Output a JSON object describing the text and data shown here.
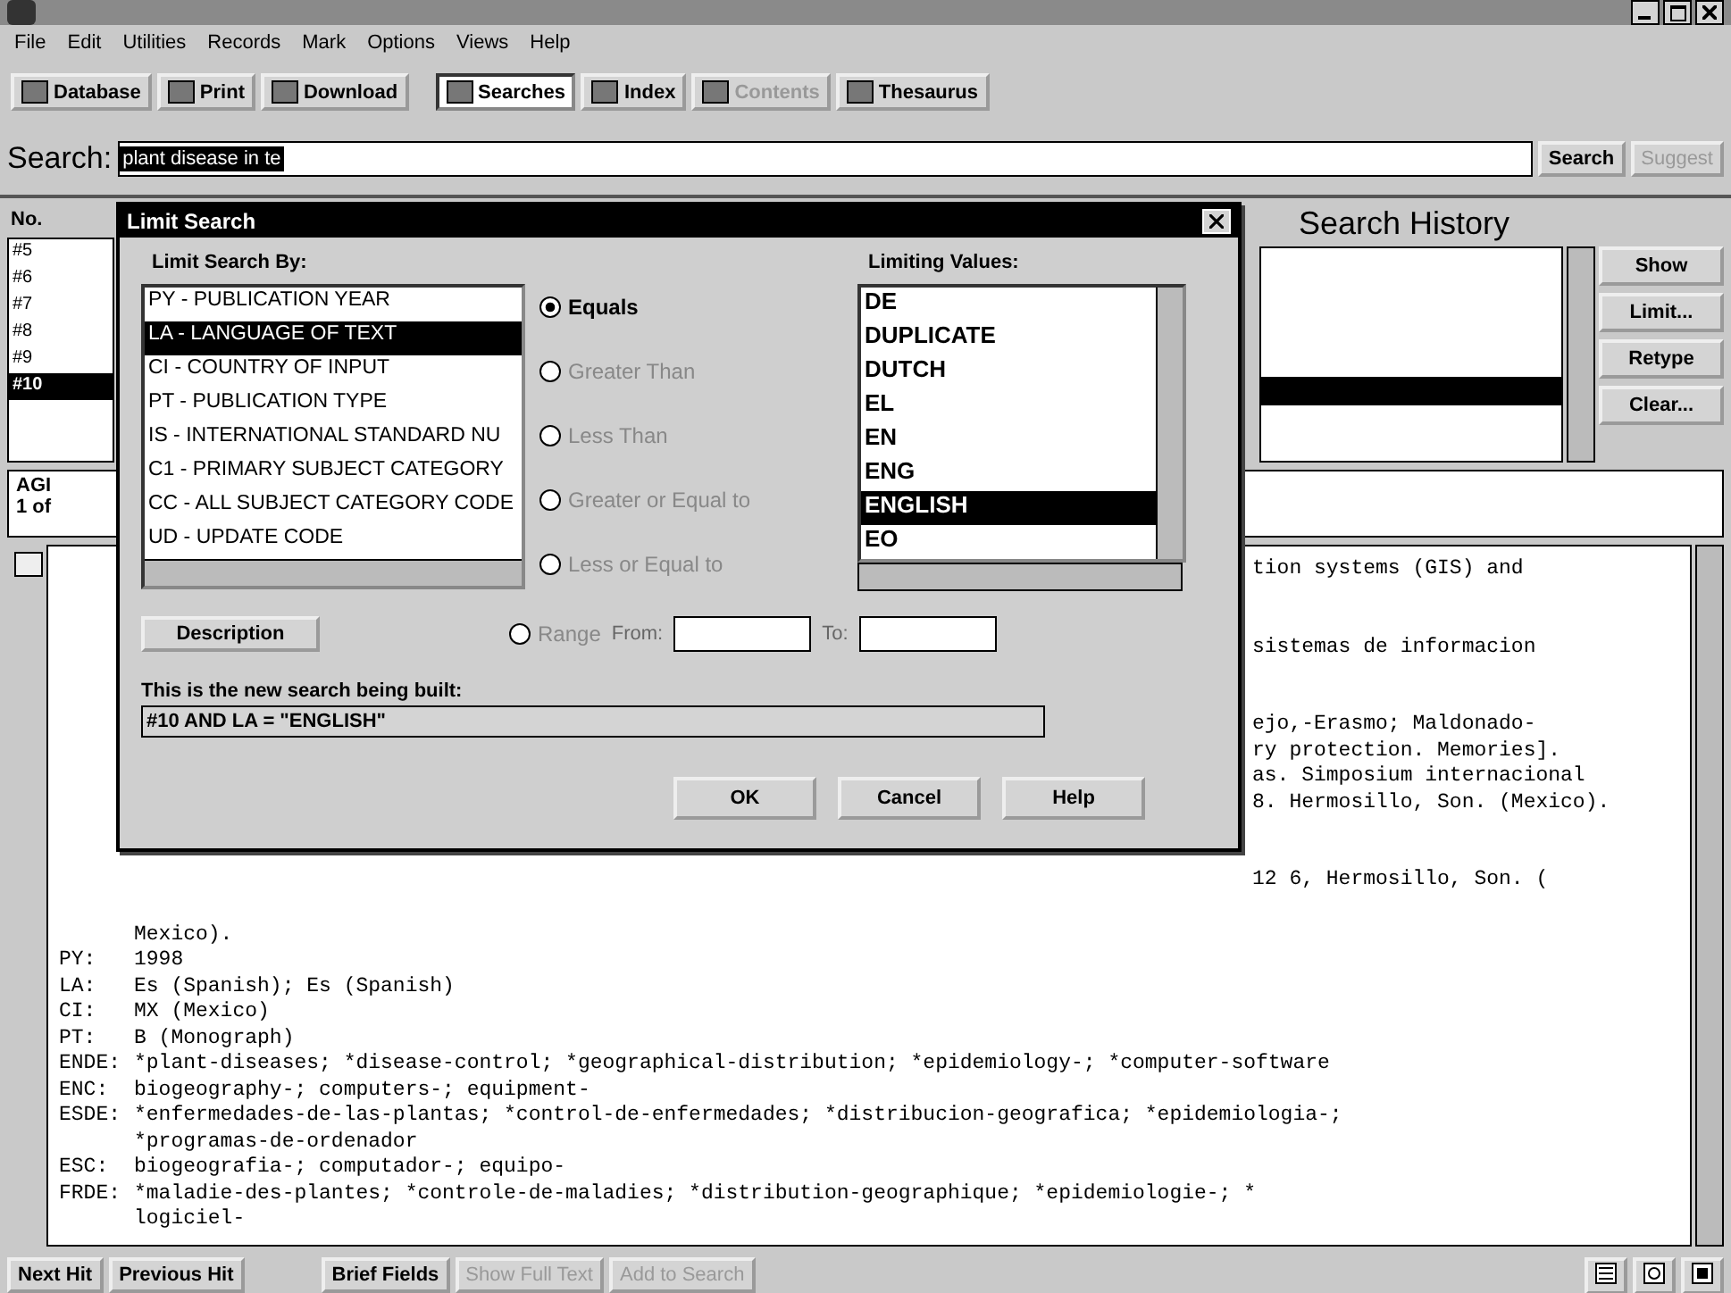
{
  "menu": [
    "File",
    "Edit",
    "Utilities",
    "Records",
    "Mark",
    "Options",
    "Views",
    "Help"
  ],
  "toolbar": [
    {
      "label": "Database",
      "pressed": false,
      "disabled": false
    },
    {
      "label": "Print",
      "pressed": false,
      "disabled": false
    },
    {
      "label": "Download",
      "pressed": false,
      "disabled": false
    },
    {
      "label": "Searches",
      "pressed": true,
      "disabled": false
    },
    {
      "label": "Index",
      "pressed": false,
      "disabled": false
    },
    {
      "label": "Contents",
      "pressed": false,
      "disabled": true
    },
    {
      "label": "Thesaurus",
      "pressed": false,
      "disabled": false
    }
  ],
  "search": {
    "label": "Search:",
    "value": "plant disease in te",
    "buttons": [
      {
        "label": "Search",
        "disabled": false
      },
      {
        "label": "Suggest",
        "disabled": true
      }
    ]
  },
  "history": {
    "column": "No.",
    "rows": [
      {
        "no": "#5",
        "selected": false
      },
      {
        "no": "#6",
        "selected": false
      },
      {
        "no": "#7",
        "selected": false
      },
      {
        "no": "#8",
        "selected": false
      },
      {
        "no": "#9",
        "selected": false
      },
      {
        "no": "#10",
        "selected": true
      }
    ],
    "title": "Search History",
    "buttons": [
      "Show",
      "Limit...",
      "Retype",
      "Clear..."
    ]
  },
  "record": {
    "database": "AGI",
    "position": "1 of",
    "partial_paragraphs": [
      {
        "lines": [
          "tion systems (GIS) and"
        ]
      },
      {
        "lines": [
          "sistemas de informacion"
        ]
      },
      {
        "lines": [
          "ejo,-Erasmo; Maldonado-",
          "ry protection. Memories].",
          "as. Simposium internacional",
          "8. Hermosillo, Son. (Mexico)."
        ]
      },
      {
        "lines": [
          "12 6, Hermosillo, Son. ("
        ]
      }
    ],
    "lines": [
      {
        "text": "Mexico)."
      },
      {
        "field": "PY:",
        "text": "1998"
      },
      {
        "field": "LA:",
        "text": "Es (Spanish); Es (Spanish)"
      },
      {
        "field": "CI:",
        "text": "MX (Mexico)"
      },
      {
        "field": "PT:",
        "text": "B (Monograph)"
      },
      {
        "field": "ENDE:",
        "text": "*plant-diseases; *disease-control; *geographical-distribution; *epidemiology-; *computer-software"
      },
      {
        "field": "ENC:",
        "text": "biogeography-; computers-; equipment-"
      },
      {
        "field": "ESDE:",
        "text": "*enfermedades-de-las-plantas; *control-de-enfermedades; *distribucion-geografica; *epidemiologia-;"
      },
      {
        "text": "*programas-de-ordenador"
      },
      {
        "field": "ESC:",
        "text": "biogeografia-; computador-; equipo-"
      },
      {
        "field": "FRDE:",
        "text": "*maladie-des-plantes; *controle-de-maladies; *distribution-geographique; *epidemiologie-; *"
      },
      {
        "text": "logiciel-"
      }
    ]
  },
  "bottom_buttons": [
    {
      "label": "Next Hit",
      "disabled": false
    },
    {
      "label": "Previous Hit",
      "disabled": false
    },
    {
      "label": "Brief Fields",
      "disabled": false
    },
    {
      "label": "Show Full Text",
      "disabled": true
    },
    {
      "label": "Add to Search",
      "disabled": true
    }
  ],
  "dialog": {
    "title": "Limit Search",
    "fields_label": "Limit Search By:",
    "fields": [
      {
        "label": "PY - PUBLICATION YEAR",
        "selected": false
      },
      {
        "label": "LA - LANGUAGE OF TEXT",
        "selected": true
      },
      {
        "label": "CI - COUNTRY OF INPUT",
        "selected": false
      },
      {
        "label": "PT - PUBLICATION TYPE",
        "selected": false
      },
      {
        "label": "IS - INTERNATIONAL STANDARD NU",
        "selected": false
      },
      {
        "label": "C1 - PRIMARY SUBJECT CATEGORY",
        "selected": false
      },
      {
        "label": "CC - ALL SUBJECT CATEGORY CODE",
        "selected": false
      },
      {
        "label": "UD - UPDATE CODE",
        "selected": false
      }
    ],
    "operators": [
      {
        "label": "Equals",
        "selected": true,
        "disabled": false
      },
      {
        "label": "Greater Than",
        "selected": false,
        "disabled": true
      },
      {
        "label": "Less Than",
        "selected": false,
        "disabled": true
      },
      {
        "label": "Greater or Equal to",
        "selected": false,
        "disabled": true
      },
      {
        "label": "Less or Equal to",
        "selected": false,
        "disabled": true
      }
    ],
    "range": {
      "label": "Range",
      "selected": false,
      "disabled": true,
      "from_label": "From:",
      "to_label": "To:"
    },
    "values_label": "Limiting Values:",
    "values": [
      {
        "label": "DE",
        "selected": false
      },
      {
        "label": "DUPLICATE",
        "selected": false
      },
      {
        "label": "DUTCH",
        "selected": false
      },
      {
        "label": "EL",
        "selected": false
      },
      {
        "label": "EN",
        "selected": false
      },
      {
        "label": "ENG",
        "selected": false
      },
      {
        "label": "ENGLISH",
        "selected": true
      },
      {
        "label": "EO",
        "selected": false
      }
    ],
    "description_button": "Description",
    "built_label": "This is the new search being built:",
    "built_value": "#10 AND LA = \"ENGLISH\"",
    "buttons": [
      "OK",
      "Cancel",
      "Help"
    ]
  }
}
